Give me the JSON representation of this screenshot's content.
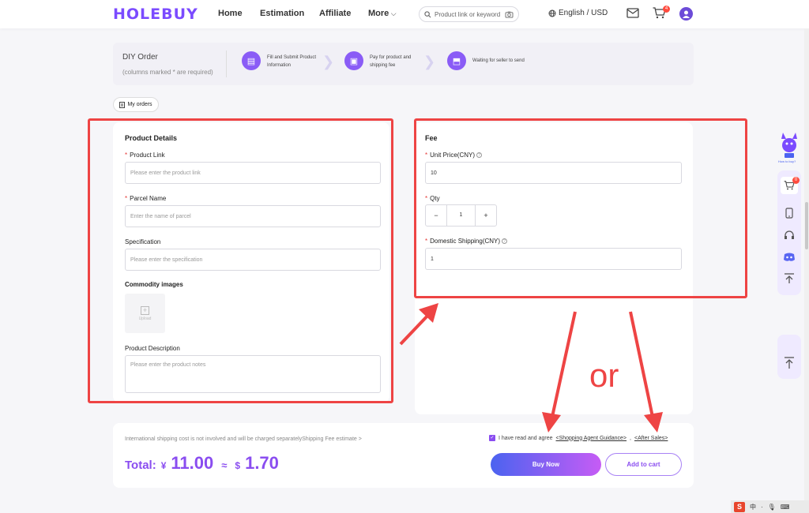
{
  "header": {
    "logo": "HOLEBUY",
    "nav": [
      "Home",
      "Estimation",
      "Affiliate",
      "More"
    ],
    "search_placeholder": "Product link or keyword",
    "language": "English / USD",
    "cart_count": "4"
  },
  "steps": {
    "title": "DIY Order",
    "subtitle": "(columns marked * are required)",
    "step1": "Fill and Submit Product Information",
    "step2": "Pay for product and shipping fee",
    "step3": "Waiting for seller to send"
  },
  "my_orders": "My orders",
  "product": {
    "section_title": "Product Details",
    "link_label": "Product Link",
    "link_placeholder": "Please enter the product link",
    "parcel_label": "Parcel Name",
    "parcel_placeholder": "Enter the name of parcel",
    "spec_label": "Specification",
    "spec_placeholder": "Please enter the specification",
    "images_label": "Commodity images",
    "upload_label": "Upload",
    "desc_label": "Product Description",
    "desc_placeholder": "Please enter the product notes"
  },
  "fee": {
    "section_title": "Fee",
    "unit_price_label": "Unit Price(CNY)",
    "unit_price_value": "10",
    "qty_label": "Qty",
    "qty_minus": "−",
    "qty_value": "1",
    "qty_plus": "+",
    "shipping_label": "Domestic Shipping(CNY)",
    "shipping_value": "1"
  },
  "summary": {
    "notice": "International shipping cost is not involved and will be charged separatelyShipping Fee estimate >",
    "total_label": "Total:",
    "cny_symbol": "¥",
    "cny_amount": "11.00",
    "approx": "≈",
    "usd_symbol": "$",
    "usd_amount": "1.70",
    "agree_text": "I have read and agree",
    "agree_link1": "<Shopping Agent Guidance>",
    "agree_sep": ",",
    "agree_link2": "<After Sales>",
    "buy_now": "Buy Now",
    "add_to_cart": "Add to cart"
  },
  "annotation": {
    "or_text": "or",
    "color": "#ee4444"
  },
  "sidebar": {
    "logo_label": "How to buy?",
    "cart_count": "0"
  },
  "colors": {
    "accent": "#8a4df0",
    "required": "#e53935"
  }
}
